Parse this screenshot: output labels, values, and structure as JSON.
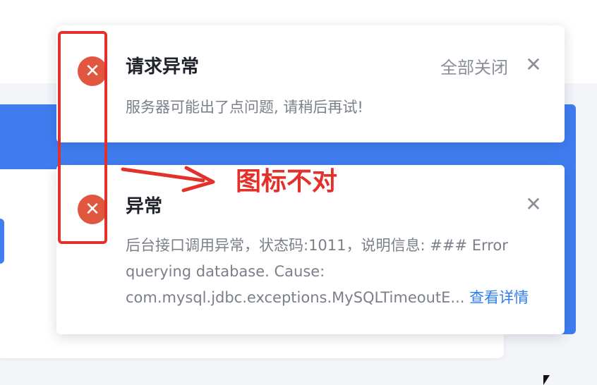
{
  "background": {
    "header_fragment": "n"
  },
  "notifications": [
    {
      "icon": "error-x-icon",
      "title": "请求异常",
      "close_all_label": "全部关闭",
      "close_glyph": "✕",
      "message": "服务器可能出了点问题, 请稍后再试!"
    },
    {
      "icon": "error-x-icon",
      "title": "异常",
      "close_glyph": "✕",
      "message": "后台接口调用异常，状态码:1011，说明信息: ### Error querying database. Cause: com.mysql.jdbc.exceptions.MySQLTimeoutE...",
      "details_link": "查看详情"
    }
  ],
  "annotation": {
    "text": "图标不对",
    "color": "#e4302a"
  },
  "colors": {
    "error_icon": "#e0563f",
    "link": "#2f7ef0",
    "banner": "#3f7df0"
  }
}
